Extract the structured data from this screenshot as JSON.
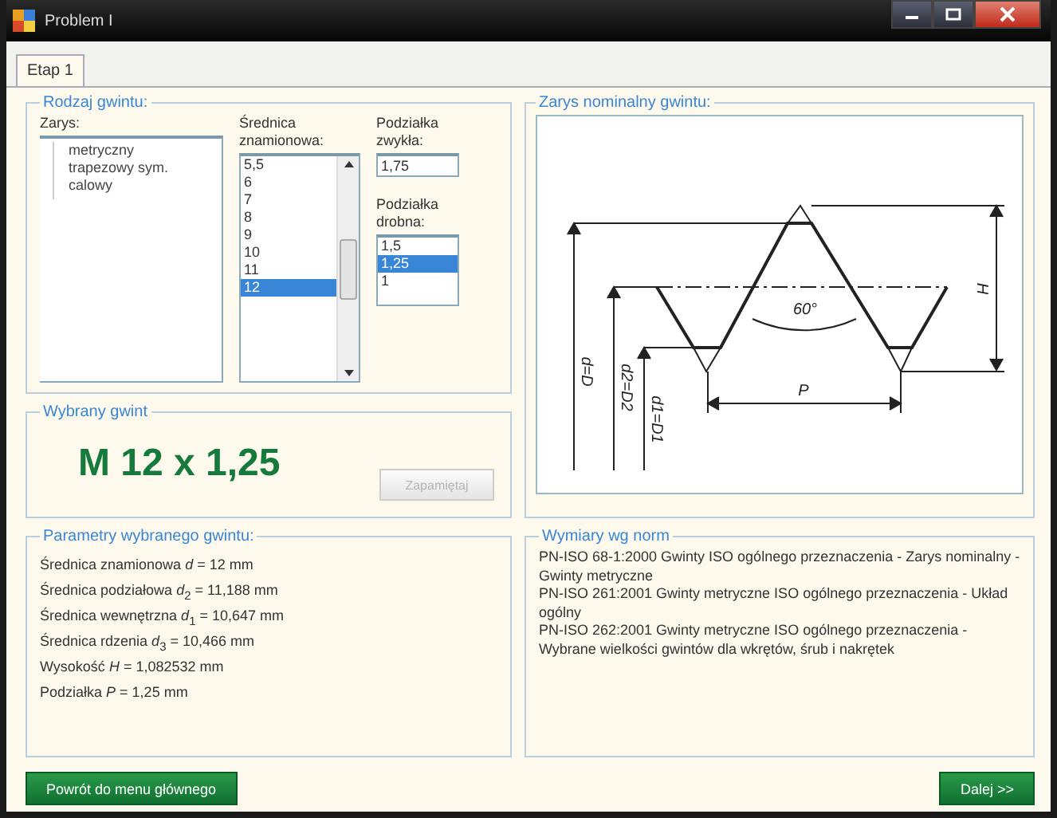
{
  "window": {
    "title": "Problem I"
  },
  "tabs": [
    {
      "label": "Etap 1",
      "selected": true
    }
  ],
  "thread_type": {
    "title": "Rodzaj gwintu:",
    "profile_label": "Zarys:",
    "profiles": [
      {
        "label": "metryczny",
        "selected": false
      },
      {
        "label": "trapezowy sym.",
        "selected": false
      },
      {
        "label": "calowy",
        "selected": false
      }
    ],
    "diameter_label": "Średnica znamionowa:",
    "diameters": [
      {
        "label": "5,5",
        "selected": false
      },
      {
        "label": "6",
        "selected": false
      },
      {
        "label": "7",
        "selected": false
      },
      {
        "label": "8",
        "selected": false
      },
      {
        "label": "9",
        "selected": false
      },
      {
        "label": "10",
        "selected": false
      },
      {
        "label": "11",
        "selected": false
      },
      {
        "label": "12",
        "selected": true
      }
    ],
    "coarse_pitch_label": "Podziałka zwykła:",
    "coarse_pitch": "1,75",
    "fine_pitch_label": "Podziałka drobna:",
    "fine_pitches": [
      {
        "label": "1,5",
        "selected": false
      },
      {
        "label": "1,25",
        "selected": true
      },
      {
        "label": "1",
        "selected": false
      }
    ]
  },
  "selected_thread": {
    "title": "Wybrany gwint",
    "designation": "M 12 x 1,25",
    "save_button": {
      "label": "Zapamiętaj",
      "disabled": true
    }
  },
  "parameters": {
    "title": "Parametry wybranego gwintu:",
    "lines": [
      "Średnica znamionowa *d* = 12 mm",
      "Średnica podziałowa *d*$_{2}$ = 11,188 mm",
      "Średnica wewnętrzna *d*$_{1}$ = 10,647 mm",
      "Średnica rdzenia *d*$_{3}$ = 10,466 mm",
      "Wysokość *H* = 1,082532 mm",
      "Podziałka *P* = 1,25 mm"
    ]
  },
  "profile_drawing": {
    "title": "Zarys nominalny gwintu:",
    "angle": "60°",
    "height": "H",
    "pitch": "P",
    "major": "d=D",
    "pitch_diameter": "d2=D2",
    "minor": "d1=D1"
  },
  "norms": {
    "title": "Wymiary wg norm",
    "lines": [
      "PN-ISO 68-1:2000 Gwinty ISO ogólnego przeznaczenia - Zarys nominalny - Gwinty metryczne",
      "PN-ISO 261:2001 Gwinty metryczne ISO ogólnego przeznaczenia - Układ ogólny",
      "PN-ISO 262:2001 Gwinty metryczne ISO ogólnego przeznaczenia - Wybrane wielkości gwintów dla wkrętów, śrub i nakrętek"
    ]
  },
  "buttons": [
    {
      "label": "Powrót do menu głównego"
    },
    {
      "label": "Dalej >>"
    }
  ]
}
